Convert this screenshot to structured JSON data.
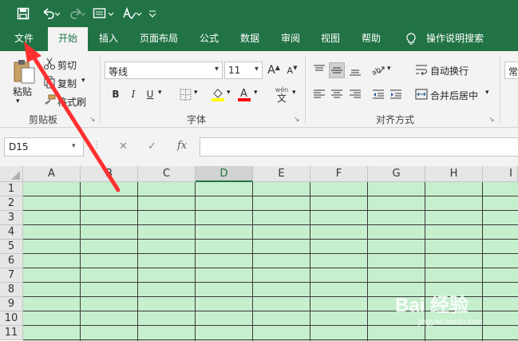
{
  "qat": {
    "save_icon": "save-icon",
    "undo_icon": "undo-icon",
    "redo_icon": "redo-icon",
    "form_icon": "form-icon",
    "spelling_icon": "spelling-icon",
    "customize_icon": "customize-qat-icon"
  },
  "tabs": [
    "文件",
    "开始",
    "插入",
    "页面布局",
    "公式",
    "数据",
    "审阅",
    "视图",
    "帮助"
  ],
  "active_tab": "开始",
  "search": {
    "label": "操作说明搜索",
    "icon": "lightbulb-icon"
  },
  "clipboard": {
    "paste_label": "粘贴",
    "cut_label": "剪切",
    "copy_label": "复制",
    "format_painter_label": "格式刷",
    "group_label": "剪贴板"
  },
  "font": {
    "font_name": "等线",
    "font_size": "11",
    "bold": "B",
    "italic": "I",
    "underline": "U",
    "grow_font": "A",
    "shrink_font": "A",
    "font_color_letter": "A",
    "phonetic": "wén",
    "phonetic_char": "文",
    "group_label": "字体",
    "highlight_color": "#ffff00",
    "font_color": "#ff0000"
  },
  "alignment": {
    "wrap_text_label": "自动换行",
    "merge_center_label": "合并后居中",
    "group_label": "对齐方式",
    "number_format_partial": "常"
  },
  "formula_bar": {
    "name_box": "D15",
    "cancel": "✕",
    "enter": "✓",
    "fx": "fx",
    "value": ""
  },
  "sheet": {
    "columns": [
      "A",
      "B",
      "C",
      "D",
      "E",
      "F",
      "G",
      "H",
      "I"
    ],
    "selected_column": "D",
    "rows": [
      "1",
      "2",
      "3",
      "4",
      "5",
      "6",
      "7",
      "8",
      "9",
      "10",
      "11"
    ],
    "fill_color": "#c6efce"
  },
  "watermark": {
    "text": "Bai 经验",
    "url": "jingyan.baidu.com"
  },
  "annotation": {
    "color": "#ff3030"
  },
  "theme": {
    "accent": "#217346"
  }
}
